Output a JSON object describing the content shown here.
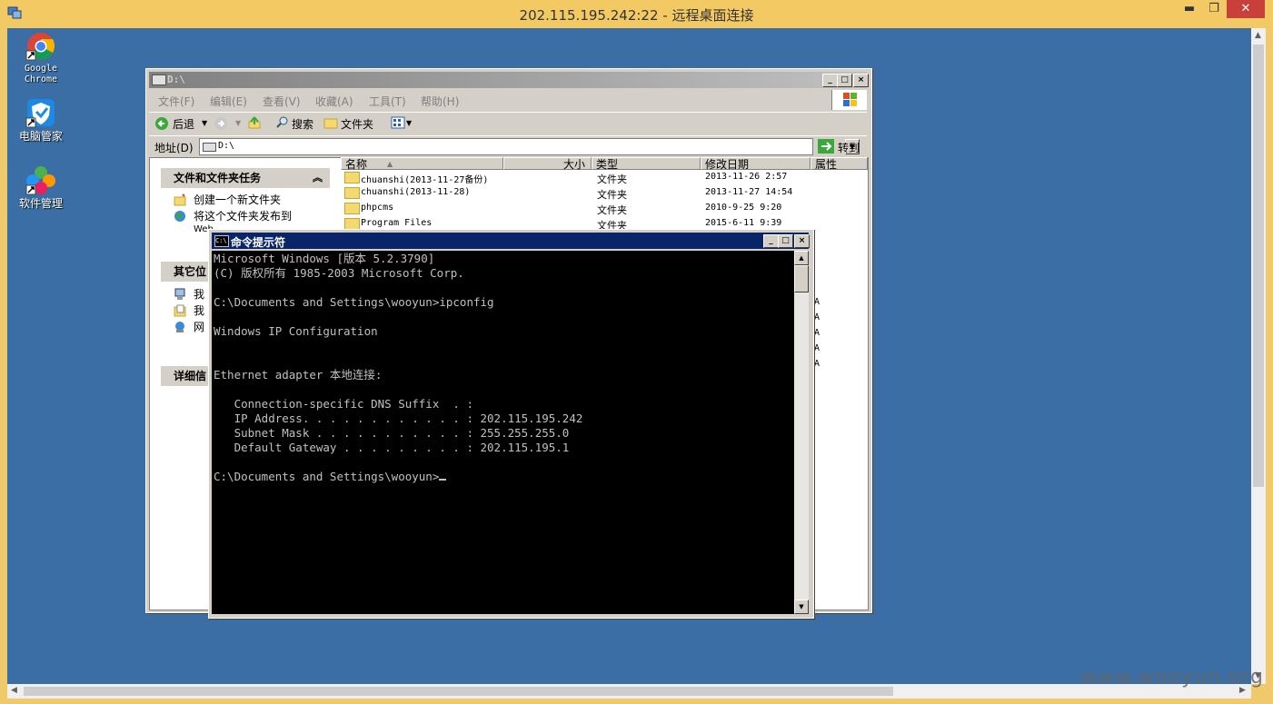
{
  "rdp": {
    "title": "202.115.195.242:22 - 远程桌面连接",
    "minimize": "▬",
    "restore": "❐",
    "close": "✕"
  },
  "desktop": {
    "icons": [
      {
        "label_line1": "Google",
        "label_line2": "Chrome",
        "icon": "chrome-icon"
      },
      {
        "label": "电脑管家",
        "icon": "shield-icon"
      },
      {
        "label": "软件管理",
        "icon": "software-manager-icon"
      }
    ]
  },
  "watermark": "www.wooyun.org",
  "explorer": {
    "title": "D:\\",
    "menu": [
      "文件(F)",
      "编辑(E)",
      "查看(V)",
      "收藏(A)",
      "工具(T)",
      "帮助(H)"
    ],
    "toolbar": {
      "back": "后退",
      "search": "搜索",
      "folders": "文件夹"
    },
    "address": {
      "label": "地址(D)",
      "value": "D:\\",
      "go": "转到"
    },
    "tasks": {
      "panel1_title": "文件和文件夹任务",
      "panel1_items": [
        "创建一个新文件夹",
        "将这个文件夹发布到",
        "Web"
      ],
      "panel2_title": "其它位",
      "panel2_items": [
        "我",
        "我",
        "网"
      ],
      "panel3_title": "详细信"
    },
    "columns": [
      "名称",
      "大小",
      "类型",
      "修改日期",
      "属性"
    ],
    "files": [
      {
        "name": "chuanshi(2013-11-27备份)",
        "type": "文件夹",
        "modified": "2013-11-26 2:57"
      },
      {
        "name": "chuanshi(2013-11-28)",
        "type": "文件夹",
        "modified": "2013-11-27 14:54"
      },
      {
        "name": "phpcms",
        "type": "文件夹",
        "modified": "2010-9-25 9:20"
      },
      {
        "name": "Program Files",
        "type": "文件夹",
        "modified": "2015-6-11 9:39"
      }
    ],
    "attrs": [
      "A",
      "A",
      "A",
      "A",
      "A"
    ]
  },
  "cmd": {
    "title": "命令提示符",
    "icon_text": "C:\\",
    "output": "Microsoft Windows [版本 5.2.3790]\n(C) 版权所有 1985-2003 Microsoft Corp.\n\nC:\\Documents and Settings\\wooyun>ipconfig\n\nWindows IP Configuration\n\n\nEthernet adapter 本地连接:\n\n   Connection-specific DNS Suffix  . :\n   IP Address. . . . . . . . . . . . : 202.115.195.242\n   Subnet Mask . . . . . . . . . . . : 255.255.255.0\n   Default Gateway . . . . . . . . . : 202.115.195.1\n\nC:\\Documents and Settings\\wooyun>"
  }
}
